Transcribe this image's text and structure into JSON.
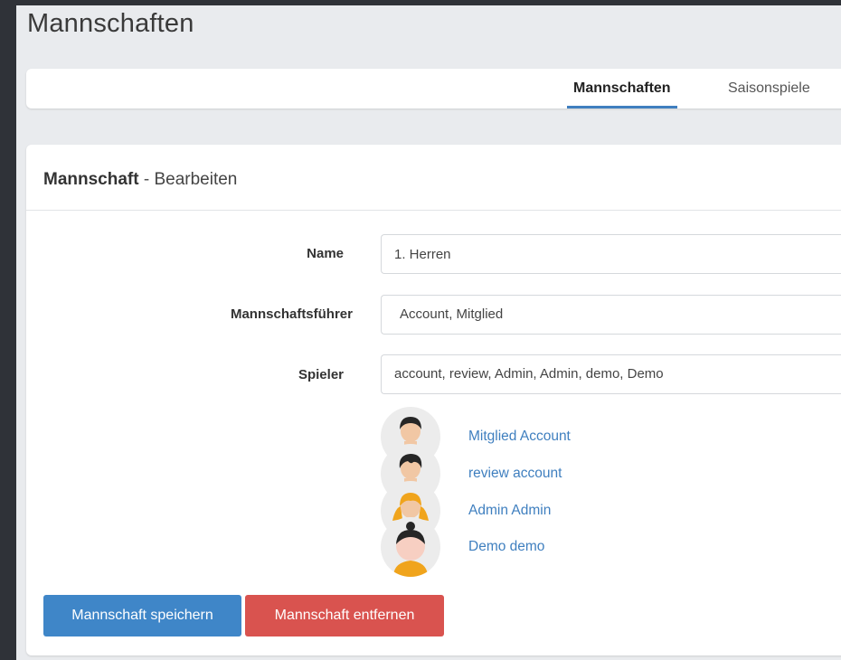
{
  "page": {
    "title": "Mannschaften"
  },
  "tabs": [
    {
      "label": "Mannschaften",
      "active": true
    },
    {
      "label": "Saisonspiele",
      "active": false
    }
  ],
  "card": {
    "title_bold": "Mannschaft",
    "title_sep": " - ",
    "title_rest": "Bearbeiten"
  },
  "form": {
    "name": {
      "label": "Name",
      "value": "1. Herren"
    },
    "captain": {
      "label": "Mannschaftsführer",
      "value": "Account, Mitglied"
    },
    "players": {
      "label": "Spieler",
      "value": "account, review, Admin, Admin, demo, Demo"
    }
  },
  "members": [
    {
      "name": "Mitglied Account",
      "avatar": "male-dark-hair-avatar"
    },
    {
      "name": "review account",
      "avatar": "male-dark-hair-avatar"
    },
    {
      "name": "Admin Admin",
      "avatar": "female-blonde-avatar"
    },
    {
      "name": "Demo demo",
      "avatar": "female-bun-avatar"
    }
  ],
  "buttons": {
    "save": "Mannschaft speichern",
    "remove": "Mannschaft entfernen"
  },
  "colors": {
    "accent": "#3f86c8",
    "danger": "#d9534f",
    "link": "#3f7fbf"
  }
}
